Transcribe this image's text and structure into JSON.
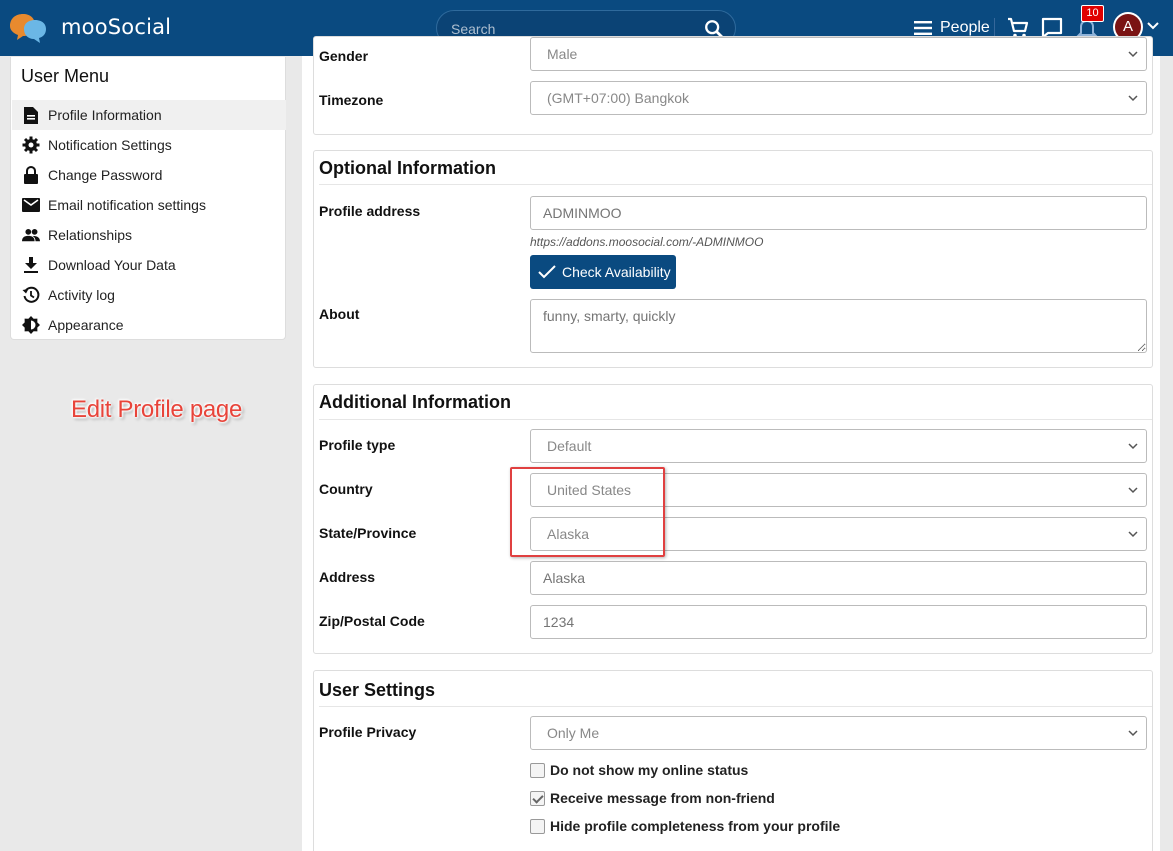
{
  "header": {
    "brand": "mooSocial",
    "search_placeholder": "Search",
    "people_label": "People",
    "notification_count": "10",
    "avatar_initial": "A"
  },
  "user_menu": {
    "title": "User Menu",
    "items": [
      {
        "label": "Profile Information",
        "icon": "document-icon",
        "active": true
      },
      {
        "label": "Notification Settings",
        "icon": "gear-icon"
      },
      {
        "label": "Change Password",
        "icon": "lock-icon"
      },
      {
        "label": "Email notification settings",
        "icon": "envelope-icon"
      },
      {
        "label": "Relationships",
        "icon": "people-icon"
      },
      {
        "label": "Download Your Data",
        "icon": "download-icon"
      },
      {
        "label": "Activity log",
        "icon": "history-icon"
      },
      {
        "label": "Appearance",
        "icon": "brightness-icon"
      }
    ]
  },
  "annotation": "Edit Profile page",
  "basic": {
    "gender_label": "Gender",
    "gender_value": "Male",
    "timezone_label": "Timezone",
    "timezone_value": "(GMT+07:00) Bangkok"
  },
  "optional": {
    "title": "Optional Information",
    "profile_address_label": "Profile address",
    "profile_address_placeholder": "ADMINMOO",
    "profile_url": "https://addons.moosocial.com/-ADMINMOO",
    "check_button": "Check Availability",
    "about_label": "About",
    "about_placeholder": "funny, smarty, quickly"
  },
  "additional": {
    "title": "Additional Information",
    "profile_type_label": "Profile type",
    "profile_type_value": "Default",
    "country_label": "Country",
    "country_value": "United States",
    "state_label": "State/Province",
    "state_value": "Alaska",
    "address_label": "Address",
    "address_placeholder": "Alaska",
    "zip_label": "Zip/Postal Code",
    "zip_placeholder": "1234"
  },
  "user_settings": {
    "title": "User Settings",
    "privacy_label": "Profile Privacy",
    "privacy_value": "Only Me",
    "checkboxes": [
      {
        "label": "Do not show my online status",
        "checked": false
      },
      {
        "label": "Receive message from non-friend",
        "checked": true
      },
      {
        "label": "Hide profile completeness from your profile",
        "checked": false
      }
    ]
  },
  "colors": {
    "header_bg": "#0a4a80",
    "button_bg": "#0a4a80",
    "badge": "#e00000",
    "annotation": "#e8443a"
  }
}
